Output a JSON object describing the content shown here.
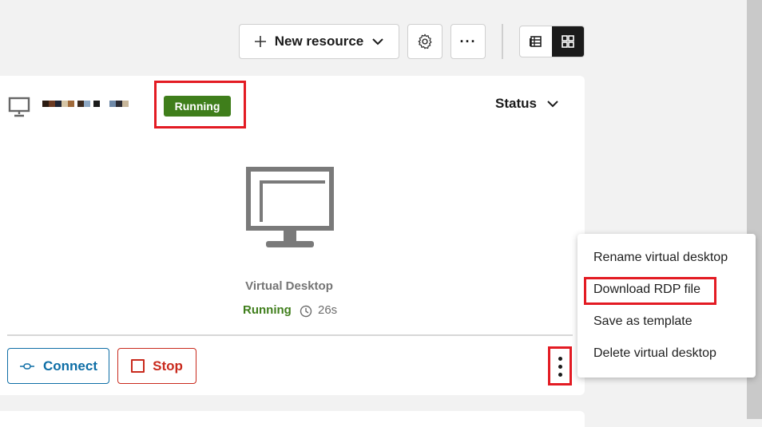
{
  "toolbar": {
    "new_resource_label": "New resource",
    "more_label": "···"
  },
  "card": {
    "status_badge": "Running",
    "sort_label": "Status",
    "resource_type": "Virtual Desktop",
    "state": "Running",
    "uptime": "26s",
    "connect_label": "Connect",
    "stop_label": "Stop"
  },
  "menu": {
    "items": [
      {
        "label": "Rename virtual desktop"
      },
      {
        "label": "Download RDP file"
      },
      {
        "label": "Save as template"
      },
      {
        "label": "Delete virtual desktop"
      }
    ]
  },
  "colors": {
    "running_green": "#3f7e1b",
    "connect_blue": "#0e6ea6",
    "stop_red": "#c92a1d",
    "highlight_red": "#e31b23"
  },
  "icons": [
    "plus-icon",
    "chevron-down-icon",
    "gear-icon",
    "list-view-icon",
    "grid-view-icon",
    "monitor-icon",
    "clock-icon",
    "plug-icon",
    "stop-icon",
    "kebab-icon"
  ]
}
